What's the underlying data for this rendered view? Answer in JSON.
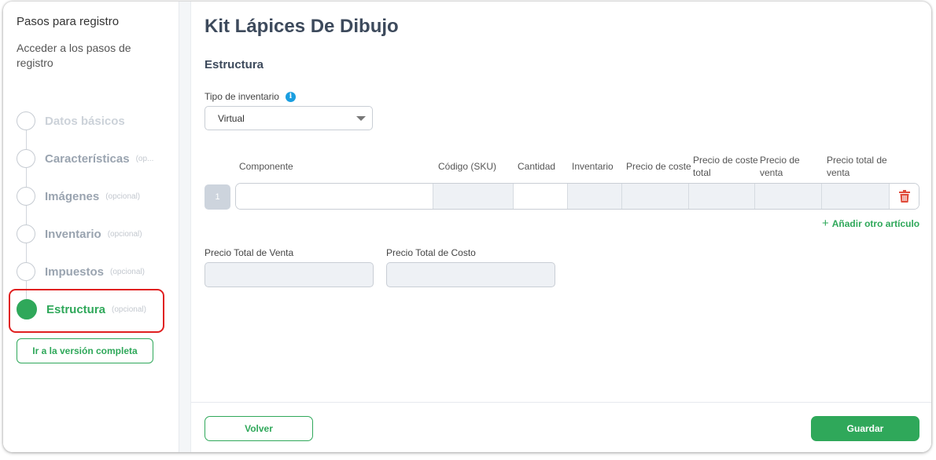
{
  "sidebar": {
    "title": "Pasos para registro",
    "description": "Acceder a los pasos de registro",
    "steps": [
      {
        "label": "Datos básicos",
        "optional": ""
      },
      {
        "label": "Características",
        "optional": "(op..."
      },
      {
        "label": "Imágenes",
        "optional": "(opcional)"
      },
      {
        "label": "Inventario",
        "optional": "(opcional)"
      },
      {
        "label": "Impuestos",
        "optional": "(opcional)"
      },
      {
        "label": "Estructura",
        "optional": "(opcional)"
      }
    ],
    "active_step": "Estructura",
    "full_version_button": "Ir a la versión completa"
  },
  "main": {
    "title": "Kit Lápices De Dibujo",
    "section_title": "Estructura",
    "inventory_type": {
      "label": "Tipo de inventario",
      "info_icon": "info-icon",
      "value": "Virtual"
    },
    "table": {
      "headers": {
        "component": "Componente",
        "sku": "Código (SKU)",
        "quantity": "Cantidad",
        "inventory": "Inventario",
        "cost_price": "Precio de coste",
        "total_cost_price": "Precio de coste total",
        "sale_price": "Precio de venta",
        "total_sale_price": "Precio total de venta"
      },
      "rows": [
        {
          "number": "1",
          "component": "",
          "sku": "",
          "quantity": "",
          "inventory": "",
          "cost_price": "",
          "total_cost_price": "",
          "sale_price": "",
          "total_sale_price": ""
        }
      ],
      "delete_icon": "trash-icon",
      "add_item_label": "Añadir otro artículo"
    },
    "totals": {
      "total_sale_label": "Precio Total de Venta",
      "total_sale_value": "",
      "total_cost_label": "Precio Total de Costo",
      "total_cost_value": ""
    }
  },
  "footer": {
    "back_button": "Volver",
    "save_button": "Guardar"
  },
  "colors": {
    "accent_green": "#2fa85a",
    "highlight_red": "#e02020",
    "info_blue": "#1a9ee0",
    "delete_red": "#e04a3a"
  }
}
